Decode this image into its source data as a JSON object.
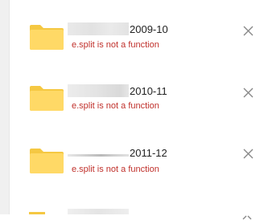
{
  "upload_list": {
    "items": [
      {
        "name": "2009-10",
        "error": "e.split is not a function",
        "icon": "folder-icon",
        "remove_icon": "close-icon"
      },
      {
        "name": "2010-11",
        "error": "e.split is not a function",
        "icon": "folder-icon",
        "remove_icon": "close-icon"
      },
      {
        "name": "2011-12",
        "error": "e.split is not a function",
        "icon": "folder-icon",
        "remove_icon": "close-icon"
      }
    ]
  },
  "colors": {
    "folder": "#ffd966",
    "folder_tab": "#f5c842",
    "error": "#c0302b",
    "close": "#888888"
  }
}
